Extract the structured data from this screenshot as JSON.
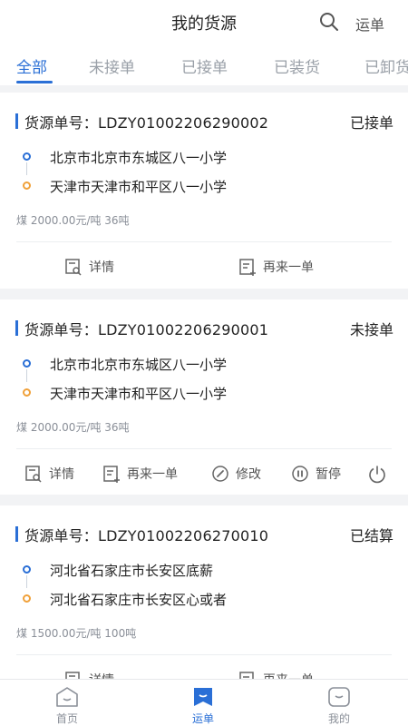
{
  "header": {
    "title": "我的货源",
    "waybill_label": "运单"
  },
  "tabs": [
    {
      "label": "全部",
      "active": true
    },
    {
      "label": "未接单",
      "active": false
    },
    {
      "label": "已接单",
      "active": false
    },
    {
      "label": "已装货",
      "active": false
    },
    {
      "label": "已卸货",
      "active": false
    }
  ],
  "cards": [
    {
      "order_prefix": "货源单号：",
      "order_no": "LDZY01002206290002",
      "status": "已接单",
      "from": "北京市北京市东城区八一小学",
      "to": "天津市天津市和平区八一小学",
      "goods": "煤  2000.00元/吨  36吨",
      "actions": [
        "详情",
        "再来一单"
      ]
    },
    {
      "order_prefix": "货源单号：",
      "order_no": "LDZY01002206290001",
      "status": "未接单",
      "from": "北京市北京市东城区八一小学",
      "to": "天津市天津市和平区八一小学",
      "goods": "煤  2000.00元/吨  36吨",
      "actions": [
        "详情",
        "再来一单",
        "修改",
        "暂停"
      ]
    },
    {
      "order_prefix": "货源单号：",
      "order_no": "LDZY01002206270010",
      "status": "已结算",
      "from": "河北省石家庄市长安区底薪",
      "to": "河北省石家庄市长安区心或者",
      "goods": "煤  1500.00元/吨  100吨",
      "actions": [
        "详情",
        "再来一单"
      ]
    }
  ],
  "bottom_nav": [
    {
      "label": "首页",
      "icon": "home-icon",
      "active": false
    },
    {
      "label": "运单",
      "icon": "waybill-icon",
      "active": true
    },
    {
      "label": "我的",
      "icon": "profile-icon",
      "active": false
    }
  ],
  "colors": {
    "accent": "#2a6fd6",
    "destination_dot": "#f0a13a"
  }
}
